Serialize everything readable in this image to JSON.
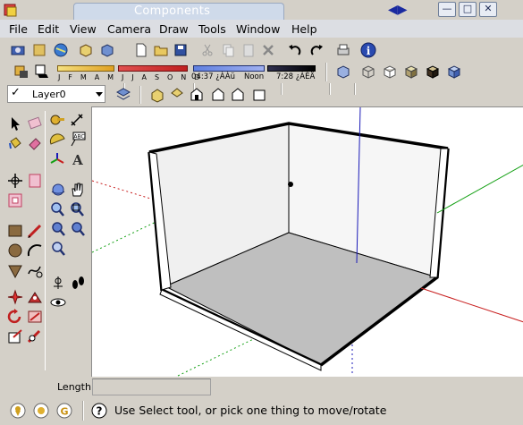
{
  "window": {
    "title": "Components"
  },
  "menu": [
    "File",
    "Edit",
    "View",
    "Camera",
    "Draw",
    "Tools",
    "Window",
    "Help"
  ],
  "shadow": {
    "months": "J F M A M J J A S O N D",
    "time_start": "04:37 ¿ÀÀü",
    "time_noon": "Noon",
    "time_end": "7:28 ¿ÀÈÄ"
  },
  "layer": {
    "current": "Layer0"
  },
  "vcb": {
    "label": "Length",
    "value": ""
  },
  "status": {
    "message": "Use Select tool, or pick one thing to move/rotate"
  },
  "colors": {
    "axis_red": "#c81e1e",
    "axis_green": "#14a014",
    "axis_blue": "#1a1ab8",
    "face_front": "#f2f2f2",
    "floor": "#bfbfbf"
  }
}
